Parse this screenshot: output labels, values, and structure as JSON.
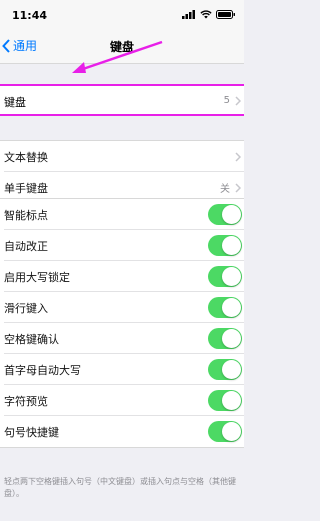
{
  "status": {
    "time": "11:44"
  },
  "nav": {
    "back_label": "通用",
    "title": "键盘"
  },
  "keyboards": {
    "label": "键盘",
    "count": "5"
  },
  "group1": [
    {
      "label": "文本替换",
      "value": ""
    },
    {
      "label": "单手键盘",
      "value": "关"
    }
  ],
  "toggles": [
    {
      "label": "智能标点",
      "on": true
    },
    {
      "label": "自动改正",
      "on": true
    },
    {
      "label": "启用大写锁定",
      "on": true
    },
    {
      "label": "滑行键入",
      "on": true
    },
    {
      "label": "空格键确认",
      "on": true
    },
    {
      "label": "首字母自动大写",
      "on": true
    },
    {
      "label": "字符预览",
      "on": true
    },
    {
      "label": "句号快捷键",
      "on": true
    }
  ],
  "footer": "轻点两下空格键插入句号（中文键盘）或插入句点与空格（其他键盘）。",
  "colors": {
    "accent": "#007aff",
    "toggle_on": "#4cd964",
    "highlight": "#e81fe8"
  }
}
